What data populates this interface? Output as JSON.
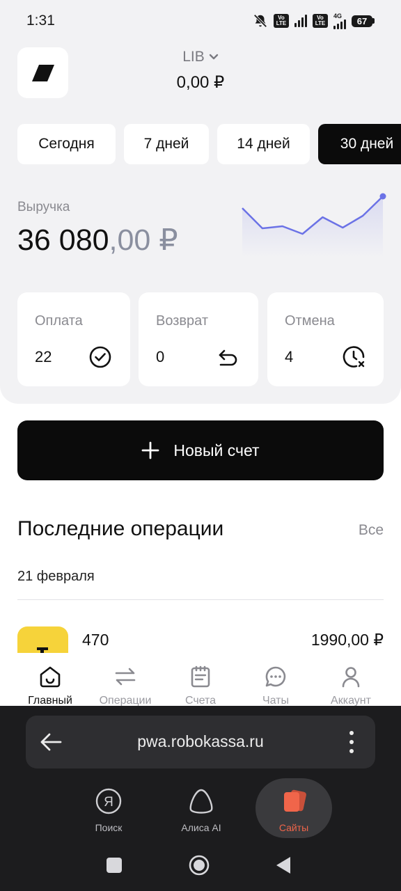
{
  "status_bar": {
    "time": "1:31",
    "volte": "Vo LTE",
    "net": "4G",
    "battery": "67"
  },
  "header": {
    "account_name": "LIB",
    "balance": "0,00 ₽"
  },
  "periods": [
    {
      "label": "Сегодня",
      "active": false
    },
    {
      "label": "7 дней",
      "active": false
    },
    {
      "label": "14 дней",
      "active": false
    },
    {
      "label": "30 дней",
      "active": true
    }
  ],
  "revenue": {
    "label": "Выручка",
    "value_main": "36 080",
    "value_fraction": ",00 ₽"
  },
  "mini_chart": {
    "type": "line",
    "values": [
      6.1,
      3.2,
      3.5,
      2.4,
      4.8,
      3.3,
      5.0,
      7.8
    ],
    "accent": "#6b72e6"
  },
  "stats": [
    {
      "label": "Оплата",
      "value": "22",
      "icon": "check-circle-icon"
    },
    {
      "label": "Возврат",
      "value": "0",
      "icon": "return-arrow-icon"
    },
    {
      "label": "Отмена",
      "value": "4",
      "icon": "clock-cancel-icon"
    }
  ],
  "new_invoice": {
    "label": "Новый счет"
  },
  "operations": {
    "title": "Последние операции",
    "all_link": "Все",
    "date": "21 февраля",
    "items": [
      {
        "name": "470",
        "amount": "1990,00 ₽",
        "thumb_color": "#f6d33a"
      }
    ]
  },
  "bottom_nav": [
    {
      "label": "Главный",
      "icon": "home-icon",
      "active": true
    },
    {
      "label": "Операции",
      "icon": "transfer-arrows-icon",
      "active": false
    },
    {
      "label": "Счета",
      "icon": "invoice-icon",
      "active": false
    },
    {
      "label": "Чаты",
      "icon": "chat-icon",
      "active": false
    },
    {
      "label": "Аккаунт",
      "icon": "user-icon",
      "active": false
    }
  ],
  "browser": {
    "url": "pwa.robokassa.ru",
    "apps": [
      {
        "label": "Поиск",
        "icon": "yandex-search-icon"
      },
      {
        "label": "Алиса AI",
        "icon": "alice-icon"
      },
      {
        "label": "Сайты",
        "icon": "sites-icon",
        "active": true
      }
    ],
    "accent": "#f0654a"
  }
}
